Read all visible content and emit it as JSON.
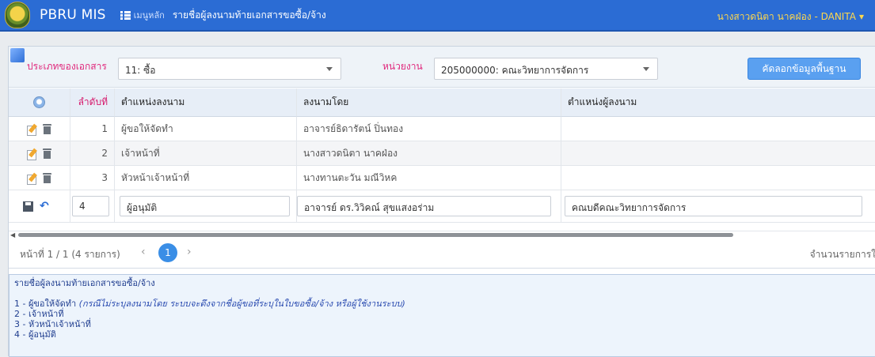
{
  "navbar": {
    "app_name": "PBRU MIS",
    "menu_label": "เมนูหลัก",
    "page_title": "รายชื่อผู้ลงนามท้ายเอกสารขอซื้อ/จ้าง",
    "user": "นางสาวดนิตา นาคฝ่อง - DANITA"
  },
  "filters": {
    "doc_type_label": "ประเภทของเอกสาร",
    "doc_type_value": "11: ซื้อ",
    "unit_label": "หน่วยงาน",
    "unit_value": "205000000: คณะวิทยาการจัดการ",
    "copy_button": "คัดลอกข้อมูลพื้นฐาน"
  },
  "table": {
    "headers": [
      "ลำดับที่",
      "ตำแหน่งลงนาม",
      "ลงนามโดย",
      "ตำแหน่งผู้ลงนาม"
    ],
    "rows": [
      {
        "no": "1",
        "position": "ผู้ขอให้จัดทำ",
        "signer": "อาจารย์ธิดารัตน์ ปิ่นทอง",
        "signer_position": ""
      },
      {
        "no": "2",
        "position": "เจ้าหน้าที่",
        "signer": "นางสาวดนิตา นาคฝ่อง",
        "signer_position": ""
      },
      {
        "no": "3",
        "position": "หัวหน้าเจ้าหน้าที่",
        "signer": "นางทานตะวัน มณีวิหค",
        "signer_position": ""
      }
    ],
    "edit_row": {
      "no": "4",
      "position": "ผู้อนุมัติ",
      "signer": "อาจารย์ ดร.วิวิคณ์  สุขแสงอร่าม",
      "signer_position": "คณบดีคณะวิทยาการจัดการ"
    }
  },
  "pager": {
    "info": "หน้าที่ 1 / 1 (4 รายการ)",
    "current_page": "1",
    "right_text": "จำนวนรายการใ"
  },
  "notes": {
    "title": "รายชื่อผู้ลงนามท้ายเอกสารขอซื้อ/จ้าง",
    "line1_prefix": "1 - ผู้ขอให้จัดทำ ",
    "line1_italic": "(กรณีไม่ระบุลงนามโดย ระบบจะดึงจากชื่อผู้ขอที่ระบุในใบขอซื้อ/จ้าง หรือผู้ใช้งานระบบ)",
    "line2": "2 - เจ้าหน้าที่",
    "line3": "3 - หัวหน้าเจ้าหน้าที่",
    "line4": "4 - ผู้อนุมัติ"
  },
  "colors": {
    "navbar": "#2b6cd4",
    "user_text": "#ffd84d",
    "label_pink": "#e0287c",
    "button": "#5aa0f0",
    "pager_active": "#3a8ee6"
  },
  "icons": [
    "logo-icon",
    "menu-grid-icon",
    "filter-icon",
    "settings-icon",
    "edit-icon",
    "trash-icon",
    "save-icon",
    "undo-icon"
  ]
}
